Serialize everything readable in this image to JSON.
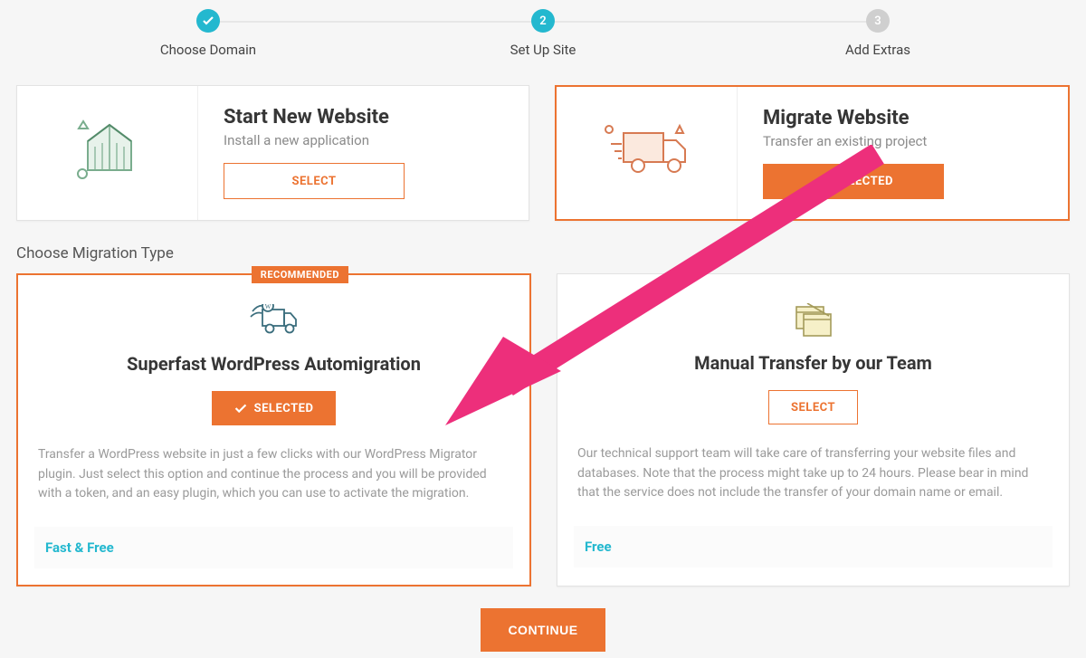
{
  "stepper": {
    "steps": [
      {
        "label": "Choose Domain",
        "indicator": "✓",
        "state": "done"
      },
      {
        "label": "Set Up Site",
        "indicator": "2",
        "state": "current"
      },
      {
        "label": "Add Extras",
        "indicator": "3",
        "state": "todo"
      }
    ]
  },
  "options": {
    "new": {
      "title": "Start New Website",
      "subtitle": "Install a new application",
      "button": "SELECT"
    },
    "migrate": {
      "title": "Migrate Website",
      "subtitle": "Transfer an existing project",
      "button": "SELECTED"
    }
  },
  "section_title": "Choose Migration Type",
  "migration": {
    "auto": {
      "badge": "RECOMMENDED",
      "title": "Superfast WordPress Automigration",
      "button": "SELECTED",
      "description": "Transfer a WordPress website in just a few clicks with our WordPress Migrator plugin. Just select this option and continue the process and you will be provided with a token, and an easy plugin, which you can use to activate the migration.",
      "price": "Fast & Free"
    },
    "manual": {
      "title": "Manual Transfer by our Team",
      "button": "SELECT",
      "description": "Our technical support team will take care of transferring your website files and databases. Note that the process might take up to 24 hours. Please bear in mind that the service does not include the transfer of your domain name or email.",
      "price": "Free"
    }
  },
  "continue_label": "CONTINUE",
  "colors": {
    "accent_orange": "#ec7331",
    "accent_teal": "#24b8cf"
  }
}
